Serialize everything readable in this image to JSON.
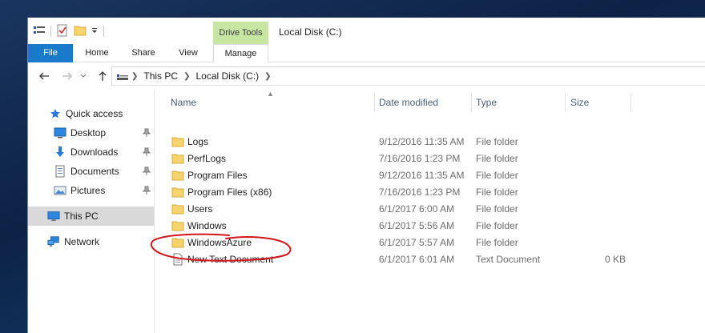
{
  "window": {
    "title": "Local Disk (C:)"
  },
  "titlebar": {
    "quick_access_icons": [
      "properties-icon",
      "checkmark-doc-icon",
      "new-folder-icon",
      "customize-qat-dropdown-icon"
    ],
    "context_tab_group": "Drive Tools"
  },
  "ribbon": {
    "tabs": [
      {
        "label": "File",
        "active": false
      },
      {
        "label": "Home"
      },
      {
        "label": "Share"
      },
      {
        "label": "View"
      },
      {
        "label": "Manage",
        "active": true
      }
    ]
  },
  "address_bar": {
    "breadcrumbs": [
      "This PC",
      "Local Disk (C:)"
    ],
    "icon": "this-pc-icon"
  },
  "nav_pane": {
    "items": [
      {
        "label": "Quick access",
        "icon": "star-icon",
        "pinned": false
      },
      {
        "label": "Desktop",
        "icon": "desktop-icon",
        "pinned": true
      },
      {
        "label": "Downloads",
        "icon": "download-arrow-icon",
        "pinned": true
      },
      {
        "label": "Documents",
        "icon": "documents-icon",
        "pinned": true
      },
      {
        "label": "Pictures",
        "icon": "pictures-icon",
        "pinned": true
      },
      {
        "label": "This PC",
        "icon": "monitor-icon",
        "selected": true
      },
      {
        "label": "Network",
        "icon": "network-icon"
      }
    ]
  },
  "file_list": {
    "columns": [
      "Name",
      "Date modified",
      "Type",
      "Size"
    ],
    "rows": [
      {
        "name": "Logs",
        "date": "9/12/2016 11:35 AM",
        "type": "File folder",
        "size": "",
        "icon": "folder-icon"
      },
      {
        "name": "PerfLogs",
        "date": "7/16/2016 1:23 PM",
        "type": "File folder",
        "size": "",
        "icon": "folder-icon"
      },
      {
        "name": "Program Files",
        "date": "9/12/2016 11:35 AM",
        "type": "File folder",
        "size": "",
        "icon": "folder-icon"
      },
      {
        "name": "Program Files (x86)",
        "date": "7/16/2016 1:23 PM",
        "type": "File folder",
        "size": "",
        "icon": "folder-icon"
      },
      {
        "name": "Users",
        "date": "6/1/2017 6:00 AM",
        "type": "File folder",
        "size": "",
        "icon": "folder-icon"
      },
      {
        "name": "Windows",
        "date": "6/1/2017 5:56 AM",
        "type": "File folder",
        "size": "",
        "icon": "folder-icon"
      },
      {
        "name": "WindowsAzure",
        "date": "6/1/2017 5:57 AM",
        "type": "File folder",
        "size": "",
        "icon": "folder-icon"
      },
      {
        "name": "New Text Document",
        "date": "6/1/2017 6:01 AM",
        "type": "Text Document",
        "size": "0 KB",
        "icon": "text-file-icon"
      }
    ]
  },
  "colors": {
    "file_tab": "#1979ca",
    "drive_tools": "#c7e6a2",
    "selected_nav": "#d9d9d9",
    "folder": "#f6d36b",
    "annotation": "#d3151b",
    "header_text": "#4c607a"
  }
}
